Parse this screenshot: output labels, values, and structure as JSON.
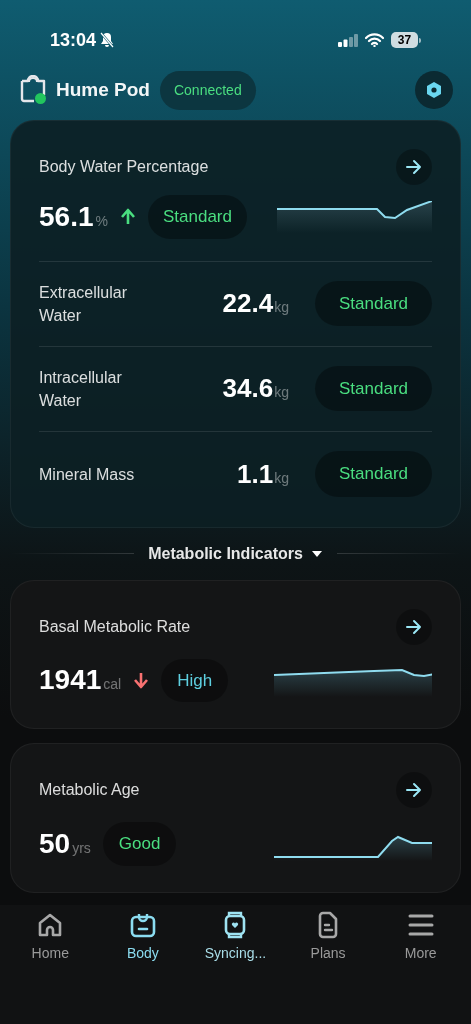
{
  "status_bar": {
    "time": "13:04",
    "battery": "37"
  },
  "header": {
    "device_name": "Hume Pod",
    "connection": "Connected"
  },
  "water_card": {
    "title": "Body Water Percentage",
    "value": "56.1",
    "unit": "%",
    "kind": "rising",
    "status": {
      "text": "Standard",
      "kind": "normal"
    },
    "rows": [
      {
        "label": "Extracellular Water",
        "value": "22.4",
        "unit": "kg",
        "status": {
          "text": "Standard",
          "kind": "normal"
        }
      },
      {
        "label": "Intracellular Water",
        "value": "34.6",
        "unit": "kg",
        "status": {
          "text": "Standard",
          "kind": "normal"
        }
      },
      {
        "label": "Mineral Mass",
        "value": "1.1",
        "unit": "kg",
        "status": {
          "text": "Standard",
          "kind": "normal"
        }
      }
    ]
  },
  "section": {
    "title": "Metabolic Indicators",
    "expanded": true
  },
  "metric_cards": [
    {
      "title": "Basal Metabolic Rate",
      "value": "1941",
      "unit": "cal",
      "kind": "falling",
      "status": {
        "text": "High",
        "kind": "high"
      }
    },
    {
      "title": "Metabolic Age",
      "value": "50",
      "unit": "yrs",
      "kind": "flat",
      "status": {
        "text": "Good",
        "kind": "normal"
      }
    }
  ],
  "tabs": [
    {
      "label": "Home",
      "selected": false,
      "highlighted": false
    },
    {
      "label": "Body",
      "selected": true,
      "highlighted": false
    },
    {
      "label": "Syncing...",
      "selected": false,
      "highlighted": true
    },
    {
      "label": "Plans",
      "selected": false,
      "highlighted": false
    },
    {
      "label": "More",
      "selected": false,
      "highlighted": false
    }
  ]
}
